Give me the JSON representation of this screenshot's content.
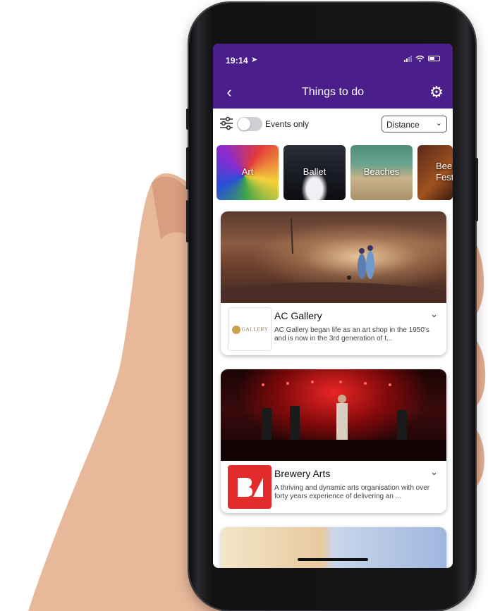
{
  "status_bar": {
    "time": "19:14"
  },
  "nav": {
    "title": "Things to do",
    "back_icon": "chevron-left-icon",
    "settings_icon": "gear-icon"
  },
  "filter": {
    "events_only_label": "Events only",
    "events_only_on": false,
    "sort_value": "Distance"
  },
  "categories": [
    {
      "label": "Art"
    },
    {
      "label": "Ballet"
    },
    {
      "label": "Beaches"
    },
    {
      "label": "Beer Festivals"
    }
  ],
  "venues": [
    {
      "name": "AC Gallery",
      "logo_text": "GALLERY",
      "description": "AC Gallery began life as an art shop in the 1950's and is now in the 3rd generation of t..."
    },
    {
      "name": "Brewery Arts",
      "description": "A thriving and dynamic arts organisation with over forty years experience of delivering an ..."
    }
  ],
  "colors": {
    "brand_purple": "#4a1f8c",
    "brewery_red": "#e32b2b"
  }
}
